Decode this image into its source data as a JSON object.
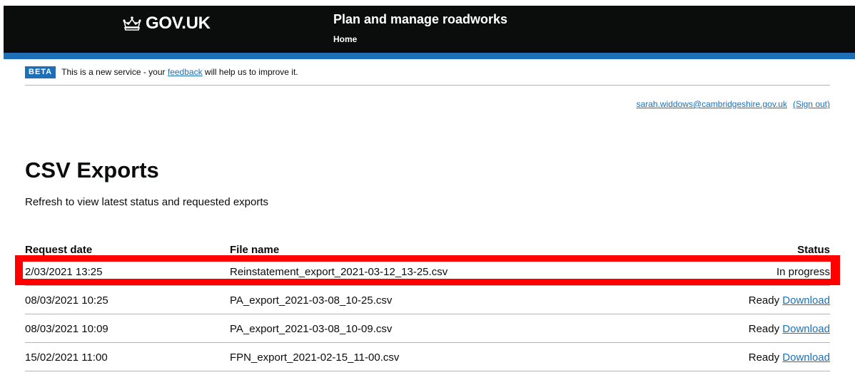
{
  "header": {
    "logo_text": "GOV.UK",
    "service_name": "Plan and manage roadworks",
    "nav_home": "Home"
  },
  "beta": {
    "tag": "BETA",
    "text_before": "This is a new service - your",
    "link": "feedback",
    "text_after": "will help us to improve it."
  },
  "user": {
    "email": "sarah.widdows@cambridgeshire.gov.uk",
    "sign_out": "(Sign out)"
  },
  "main": {
    "title": "CSV Exports",
    "intro": "Refresh to view latest status and requested exports"
  },
  "table": {
    "headers": {
      "date": "Request date",
      "file": "File name",
      "status": "Status"
    },
    "rows": [
      {
        "date": "2/03/2021 13:25",
        "file": "Reinstatement_export_2021-03-12_13-25.csv",
        "status": "In progress",
        "link": ""
      },
      {
        "date": "08/03/2021 10:25",
        "file": "PA_export_2021-03-08_10-25.csv",
        "status": "Ready",
        "link": "Download"
      },
      {
        "date": "08/03/2021 10:09",
        "file": "PA_export_2021-03-08_10-09.csv",
        "status": "Ready",
        "link": "Download"
      },
      {
        "date": "15/02/2021 11:00",
        "file": "FPN_export_2021-02-15_11-00.csv",
        "status": "Ready",
        "link": "Download"
      }
    ]
  },
  "colors": {
    "header_bg": "#0b0c0c",
    "accent_blue": "#1d70b8",
    "highlight": "#ff0000"
  },
  "icons": {
    "logo": "crown-icon"
  }
}
